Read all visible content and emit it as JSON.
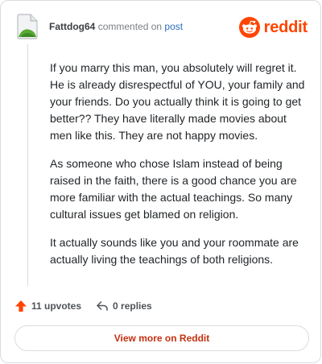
{
  "comment": {
    "author": "Fattdog64",
    "action": "commented on",
    "target_link": "post",
    "paragraphs": [
      "If you marry this man, you absolutely will regret it. He is already disrespectful of YOU, your family and your friends. Do you actually think it is going to get better?? They have literally made movies about men like this. They are not happy movies.",
      "As someone who chose Islam instead of being raised in the faith, there is a good chance you are more familiar with the actual teachings. So many cultural issues get blamed on religion.",
      "It actually sounds like you and your roommate are actually living the teachings of both religions."
    ]
  },
  "brand": {
    "wordmark": "reddit",
    "accent_color": "#ff4500"
  },
  "footer": {
    "upvotes": "11 upvotes",
    "replies": "0 replies",
    "upvote_icon": "upvote-arrow-icon",
    "reply_icon": "reply-arrow-icon"
  },
  "cta": {
    "label": "View more on Reddit"
  }
}
